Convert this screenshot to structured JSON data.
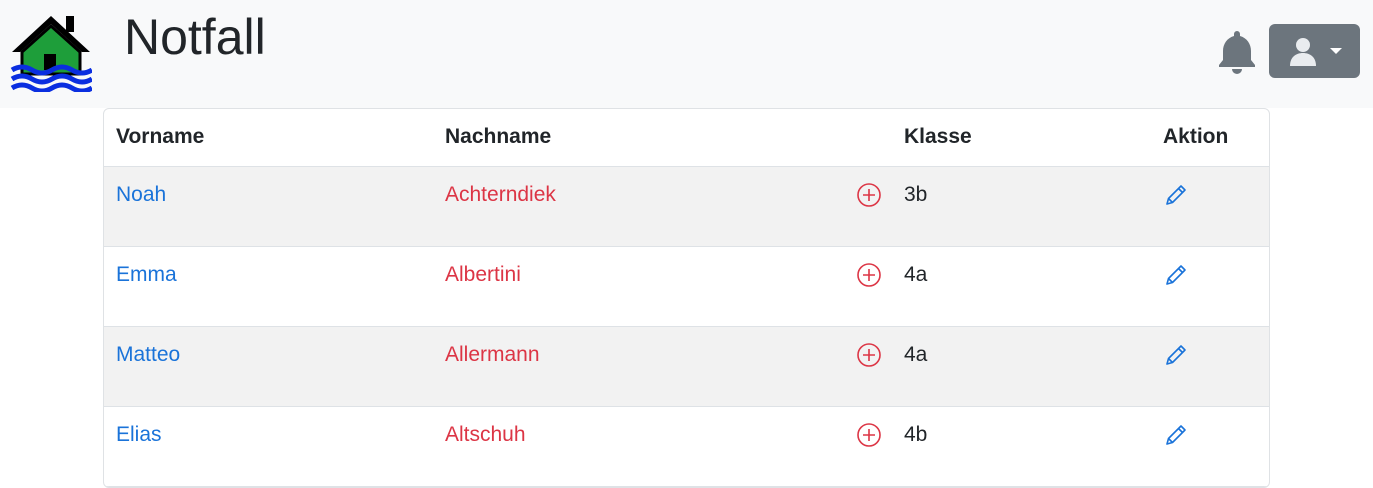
{
  "app": {
    "brand": "Notfall",
    "logo_icon": "house-flood-icon",
    "notification_icon": "bell-icon",
    "user_icon": "user-avatar-icon"
  },
  "table": {
    "headers": [
      "Vorname",
      "Nachname",
      "",
      "Klasse",
      "Aktion"
    ],
    "rows": [
      {
        "first": "Noah",
        "last": "Achterndiek",
        "class": "3b"
      },
      {
        "first": "Emma",
        "last": "Albertini",
        "class": "4a"
      },
      {
        "first": "Matteo",
        "last": "Allermann",
        "class": "4a"
      },
      {
        "first": "Elias",
        "last": "Altschuh",
        "class": "4b"
      }
    ],
    "add_icon": "plus-circle-icon",
    "edit_icon": "pencil-icon"
  },
  "colors": {
    "navbar_bg": "#f8f9fa",
    "link_blue": "#1a73d9",
    "danger_red": "#dc3545",
    "user_button_bg": "#6c757d"
  }
}
